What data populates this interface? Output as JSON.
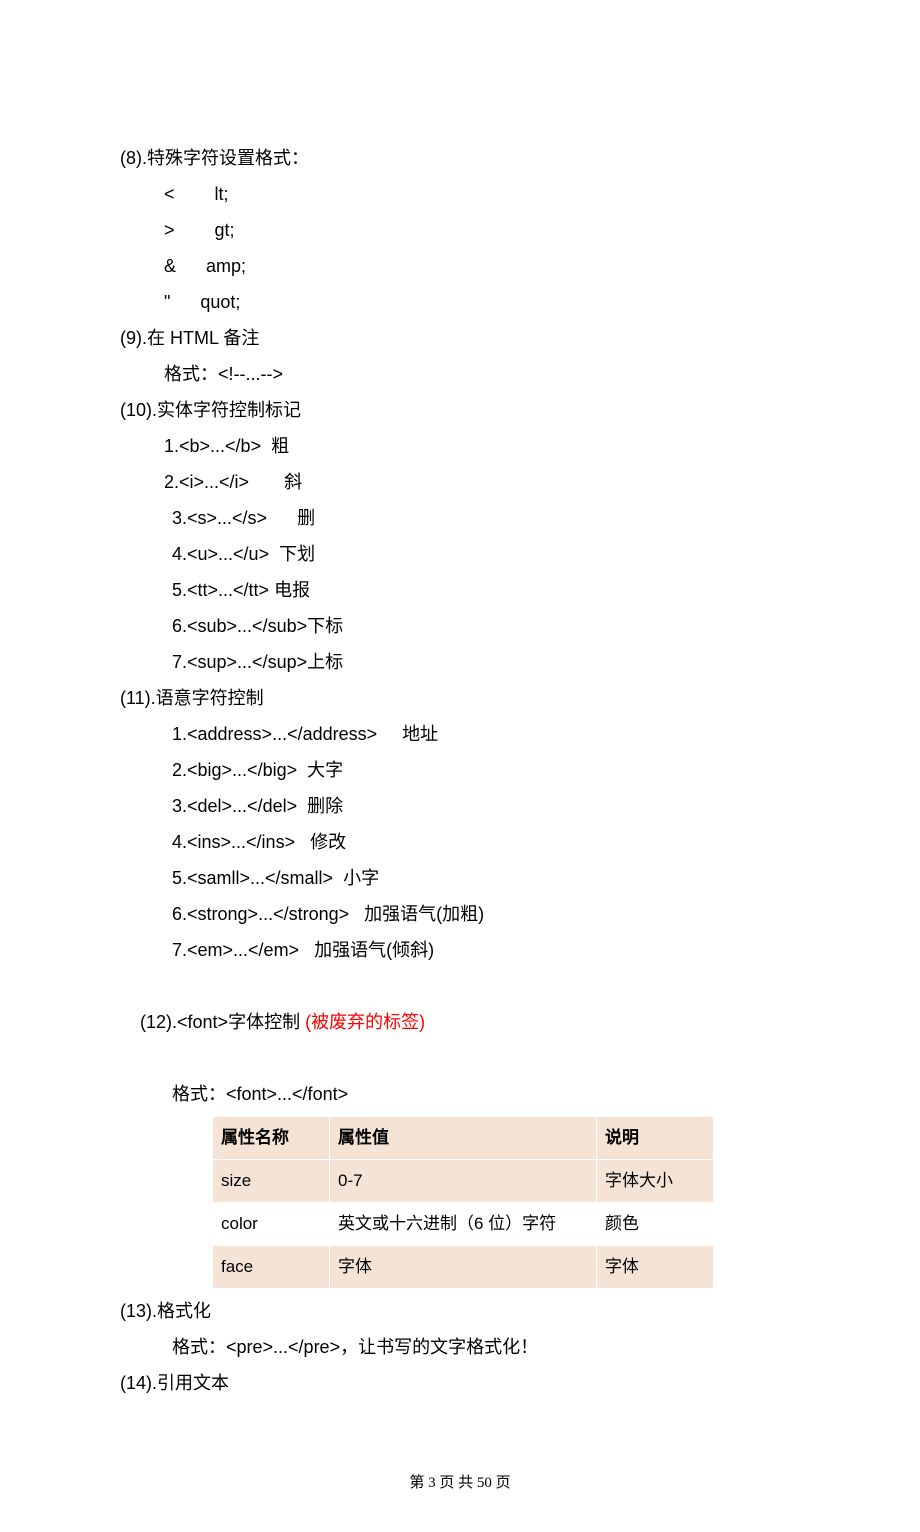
{
  "s8": {
    "title": "(8).特殊字符设置格式：",
    "rows": [
      "<        lt;",
      ">        gt;",
      "&      amp;",
      "\"      quot;"
    ]
  },
  "s9": {
    "title": "(9).在 HTML 备注",
    "body": "格式：<!--...-->"
  },
  "s10": {
    "title": "(10).实体字符控制标记",
    "rows": [
      "1.<b>...</b>  粗",
      "2.<i>...</i>       斜",
      "3.<s>...</s>      删",
      "4.<u>...</u>  下划",
      "5.<tt>...</tt> 电报",
      "6.<sub>...</sub>下标",
      "7.<sup>...</sup>上标"
    ]
  },
  "s11": {
    "title": "(11).语意字符控制",
    "rows": [
      "1.<address>...</address>     地址",
      "2.<big>...</big>  大字",
      "3.<del>...</del>  删除",
      "4.<ins>...</ins>   修改",
      "5.<samll>...</small>  小字",
      "6.<strong>...</strong>   加强语气(加粗)",
      "7.<em>...</em>   加强语气(倾斜)"
    ]
  },
  "s12": {
    "title_plain": "(12).<font>字体控制 ",
    "title_red": "(被废弃的标签)",
    "format": "格式：<font>...</font>",
    "table": {
      "headers": [
        "属性名称",
        "属性值",
        "说明"
      ],
      "rows": [
        [
          "size",
          "0-7",
          "字体大小"
        ],
        [
          "color",
          "英文或十六进制（6 位）字符",
          "颜色"
        ],
        [
          "face",
          "字体",
          "字体"
        ]
      ]
    }
  },
  "s13": {
    "title": "(13).格式化",
    "body": "格式：<pre>...</pre>，让书写的文字格式化！"
  },
  "s14": {
    "title": "(14).引用文本"
  },
  "footer": "第 3 页  共 50 页"
}
